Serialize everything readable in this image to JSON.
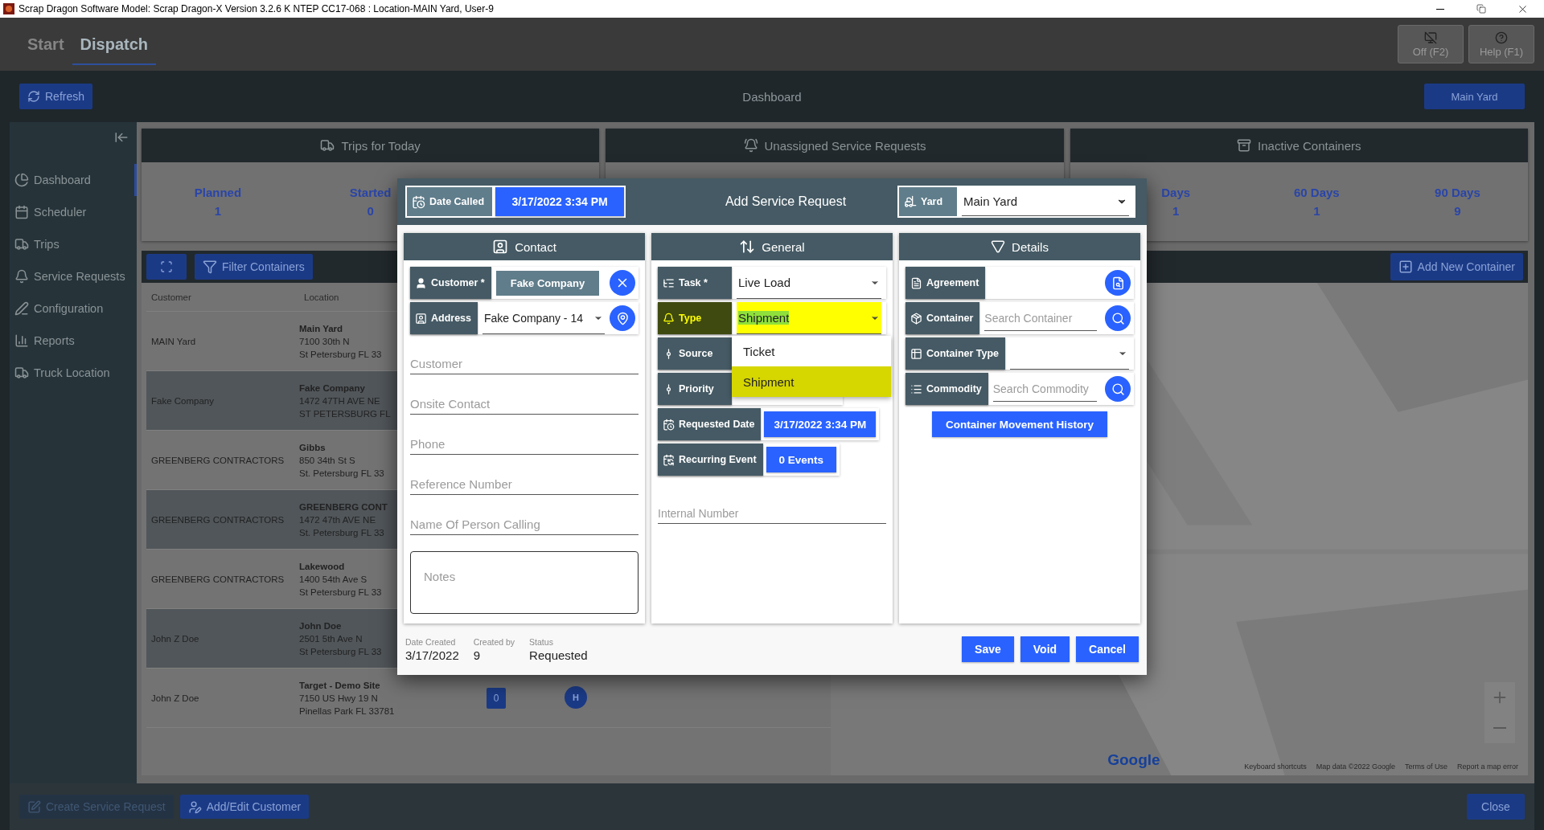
{
  "window": {
    "title": "Scrap Dragon Software Model: Scrap Dragon-X Version 3.2.6 K NTEP CC17-068 : Location-MAIN Yard, User-9"
  },
  "tabs": [
    {
      "label": "Start",
      "selected": false
    },
    {
      "label": "Dispatch",
      "selected": true
    }
  ],
  "header_buttons": [
    {
      "label": "Off (F2)",
      "kind": "monitor"
    },
    {
      "label": "Help (F1)",
      "kind": "help"
    }
  ],
  "toolbar": {
    "refresh": "Refresh",
    "title": "Dashboard",
    "yard": "Main Yard"
  },
  "sidebar": {
    "items": [
      {
        "label": "Dashboard",
        "selected": true
      },
      {
        "label": "Scheduler",
        "selected": false
      },
      {
        "label": "Trips",
        "selected": false
      },
      {
        "label": "Service Requests",
        "selected": false
      },
      {
        "label": "Configuration",
        "selected": false
      },
      {
        "label": "Reports",
        "selected": false
      },
      {
        "label": "Truck Location",
        "selected": false
      }
    ]
  },
  "cards": [
    {
      "title": "Trips for Today",
      "stats": [
        {
          "label": "Planned",
          "value": "1"
        },
        {
          "label": "Started",
          "value": "0"
        }
      ]
    },
    {
      "title": "Unassigned Service Requests"
    },
    {
      "title": "Inactive Containers",
      "stats": [
        {
          "label": "Days",
          "value": "1"
        },
        {
          "label": "60 Days",
          "value": "1"
        },
        {
          "label": "90 Days",
          "value": "9"
        }
      ]
    }
  ],
  "containers_toolbar": {
    "filter": "Filter Containers",
    "add": "Add New Container"
  },
  "table": {
    "columns": [
      "Customer",
      "Location"
    ],
    "rows": [
      {
        "customer": "MAIN Yard",
        "location": "Main Yard",
        "lines": [
          "7100 30th N",
          "St Petersburg FL 33"
        ]
      },
      {
        "customer": "Fake Company",
        "location": "Fake Company",
        "lines": [
          "1472 47TH AVE NE",
          "ST PETERSBURG FL"
        ]
      },
      {
        "customer": "GREENBERG CONTRACTORS",
        "location": "Gibbs",
        "lines": [
          "850 34th St S",
          "St. Petersburg FL 33"
        ]
      },
      {
        "customer": "GREENBERG CONTRACTORS",
        "location": "GREENBERG CONT",
        "lines": [
          "1472 47th AVE NE",
          "St. Petersburg FL 33"
        ]
      },
      {
        "customer": "GREENBERG CONTRACTORS",
        "location": "Lakewood",
        "lines": [
          "1400 54th Ave S",
          "St Petersburg FL 33"
        ]
      },
      {
        "customer": "John Z Doe",
        "location": "John Doe",
        "lines": [
          "2501 5th Ave N",
          "St Petersburg FL 33"
        ]
      },
      {
        "customer": "John Z Doe",
        "location": "Target - Demo Site",
        "lines": [
          "7150 US Hwy 19 N",
          "Pinellas Park FL 33781"
        ],
        "badge": "0",
        "marker": "H"
      }
    ]
  },
  "map": {
    "logo": "Google",
    "footer": [
      "Keyboard shortcuts",
      "Map data ©2022 Google",
      "Terms of Use",
      "Report a map error"
    ]
  },
  "bottom_bar": {
    "buttons": [
      {
        "label": "Create Service Request",
        "disabled": true
      },
      {
        "label": "Add/Edit Customer",
        "disabled": false
      }
    ],
    "close": "Close"
  },
  "dialog": {
    "date_called": {
      "label": "Date Called",
      "value": "3/17/2022 3:34 PM"
    },
    "title": "Add Service Request",
    "yard": {
      "label": "Yard",
      "value": "Main Yard"
    },
    "panels": {
      "contact": {
        "title": "Contact",
        "customer": {
          "label": "Customer *",
          "value": "Fake Company"
        },
        "address": {
          "label": "Address",
          "value": "Fake Company - 14"
        },
        "fields": [
          {
            "placeholder": "Customer"
          },
          {
            "placeholder": "Onsite Contact"
          },
          {
            "placeholder": "Phone"
          },
          {
            "placeholder": "Reference Number"
          },
          {
            "placeholder": "Name Of Person Calling"
          }
        ],
        "notes": {
          "placeholder": "Notes"
        }
      },
      "general": {
        "title": "General",
        "rows": [
          {
            "kind": "select",
            "label": "Task *",
            "value": "Live Load",
            "highlighted": false
          },
          {
            "kind": "select",
            "label": "Type",
            "value": "Shipment",
            "highlighted": true
          },
          {
            "kind": "label",
            "label": "Source",
            "highlighted": false
          },
          {
            "kind": "label",
            "label": "Priority",
            "highlighted": false
          },
          {
            "kind": "date",
            "label": "Requested Date",
            "value": "3/17/2022 3:34 PM",
            "highlighted": false
          },
          {
            "kind": "button",
            "label": "Recurring Event",
            "value": "0 Events",
            "highlighted": false
          }
        ],
        "menu": [
          {
            "label": "Ticket",
            "highlighted": false
          },
          {
            "label": "Shipment",
            "highlighted": true
          }
        ],
        "internal_number": {
          "placeholder": "Internal Number"
        }
      },
      "details": {
        "title": "Details",
        "rows": [
          {
            "kind": "document",
            "label": "Agreement"
          },
          {
            "kind": "search",
            "label": "Container",
            "placeholder": "Search Container"
          },
          {
            "kind": "select",
            "label": "Container Type"
          },
          {
            "kind": "search",
            "label": "Commodity",
            "placeholder": "Search Commodity"
          }
        ],
        "history": "Container Movement History"
      }
    },
    "meta": [
      {
        "label": "Date Created",
        "value": "3/17/2022"
      },
      {
        "label": "Created by",
        "value": "9"
      },
      {
        "label": "Status",
        "value": "Requested"
      }
    ],
    "buttons": [
      "Save",
      "Void",
      "Cancel"
    ]
  }
}
